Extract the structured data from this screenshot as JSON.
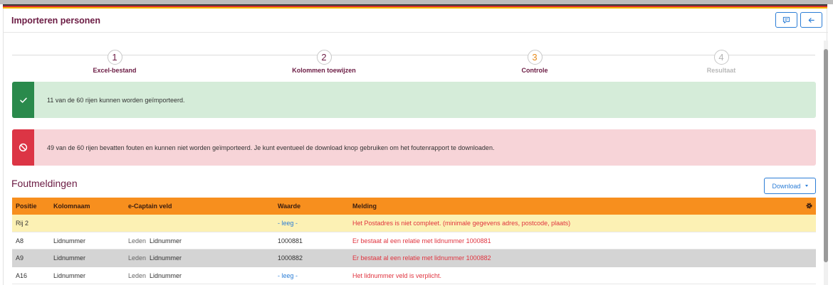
{
  "page": {
    "title": "Importeren personen"
  },
  "icons": {
    "chat": "chat-bubble-icon",
    "back": "arrow-left-icon",
    "success": "check-icon",
    "error": "ban-icon",
    "settings": "gear-icon",
    "dropdown": "caret-down-icon"
  },
  "colors": {
    "brand": "#6b1b43",
    "accent": "#2b7dd6",
    "table_header": "#f78f1e",
    "success": "#2a8a4c",
    "danger": "#dc3545",
    "warning_row": "#fcf1b4"
  },
  "stepper": {
    "current_step": 3,
    "steps": [
      {
        "number": "1",
        "label": "Excel-bestand",
        "state": "done"
      },
      {
        "number": "2",
        "label": "Kolommen toewijzen",
        "state": "done"
      },
      {
        "number": "3",
        "label": "Controle",
        "state": "active"
      },
      {
        "number": "4",
        "label": "Resultaat",
        "state": "pending"
      }
    ]
  },
  "alerts": {
    "success": {
      "text": "11 van de 60 rijen kunnen worden geïmporteerd."
    },
    "error": {
      "text": "49 van de 60 rijen bevatten fouten en kunnen niet worden geïmporteerd. Je kunt eventueel de download knop gebruiken om het foutenrapport te downloaden."
    }
  },
  "errors_section": {
    "title": "Foutmeldingen",
    "download_label": "Download",
    "table": {
      "headers": {
        "position": "Positie",
        "column": "Kolomnaam",
        "field": "e-Captain veld",
        "value": "Waarde",
        "message": "Melding"
      },
      "rows": [
        {
          "position": "Rij 2",
          "column": "",
          "field_group": "",
          "field": "",
          "value": "- leeg -",
          "message": "Het Postadres is niet compleet. (minimale gegevens adres, postcode, plaats)"
        },
        {
          "position": "A8",
          "column": "Lidnummer",
          "field_group": "Leden",
          "field": "Lidnummer",
          "value": "1000881",
          "message": "Er bestaat al een relatie met lidnummer 1000881"
        },
        {
          "position": "A9",
          "column": "Lidnummer",
          "field_group": "Leden",
          "field": "Lidnummer",
          "value": "1000882",
          "message": "Er bestaat al een relatie met lidnummer 1000882"
        },
        {
          "position": "A16",
          "column": "Lidnummer",
          "field_group": "Leden",
          "field": "Lidnummer",
          "value": "- leeg -",
          "message": "Het lidnummer veld is verplicht."
        }
      ]
    }
  }
}
